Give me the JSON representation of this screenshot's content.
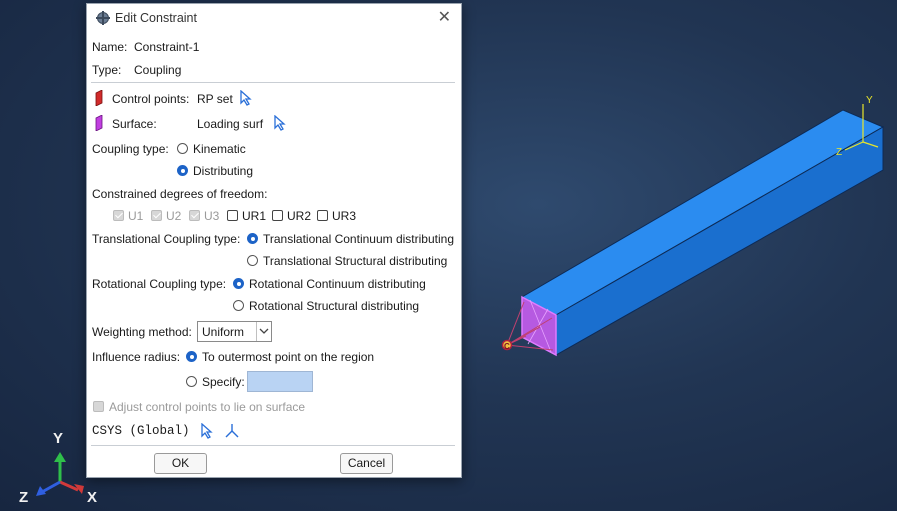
{
  "dialog": {
    "title": "Edit Constraint",
    "name_label": "Name:",
    "name_value": "Constraint-1",
    "type_label": "Type:",
    "type_value": "Coupling",
    "control_points_label": "Control points:",
    "control_points_value": "RP set",
    "surface_label": "Surface:",
    "surface_value": "Loading surf",
    "coupling_type_label": "Coupling type:",
    "coupling_options": [
      "Kinematic",
      "Distributing"
    ],
    "coupling_selected": "Distributing",
    "dof_label": "Constrained degrees of freedom:",
    "dof": [
      {
        "label": "U1",
        "checked": true,
        "enabled": false
      },
      {
        "label": "U2",
        "checked": true,
        "enabled": false
      },
      {
        "label": "U3",
        "checked": true,
        "enabled": false
      },
      {
        "label": "UR1",
        "checked": false,
        "enabled": true
      },
      {
        "label": "UR2",
        "checked": false,
        "enabled": true
      },
      {
        "label": "UR3",
        "checked": false,
        "enabled": true
      }
    ],
    "trans_label": "Translational Coupling type:",
    "trans_options": [
      "Translational Continuum distributing",
      "Translational Structural distributing"
    ],
    "trans_selected": "Translational Continuum distributing",
    "rot_label": "Rotational Coupling type:",
    "rot_options": [
      "Rotational Continuum distributing",
      "Rotational Structural distributing"
    ],
    "rot_selected": "Rotational Continuum distributing",
    "weighting_label": "Weighting method:",
    "weighting_value": "Uniform",
    "influence_label": "Influence radius:",
    "influence_options": [
      "To outermost point on the region",
      "Specify:"
    ],
    "influence_selected": "To outermost point on the region",
    "specify_value": "",
    "adjust_label": "Adjust control points to lie on surface",
    "csys_label": "CSYS (Global)",
    "ok_label": "OK",
    "cancel_label": "Cancel"
  },
  "viewport": {
    "triad": {
      "x": "X",
      "y": "Y",
      "z": "Z"
    },
    "model_triad": {
      "y": "Y",
      "z": "Z"
    },
    "rp_label": "C",
    "model_color": "#1e7fe0",
    "surface_color": "#b03fe8"
  },
  "icons": {
    "title": "constraint-icon",
    "close": "close-icon",
    "control_points": "red-point-marker-icon",
    "surface": "magenta-surface-marker-icon",
    "select": "cursor-arrow-icon",
    "csys_axes": "axes-icon",
    "dropdown": "chevron-down-icon"
  }
}
